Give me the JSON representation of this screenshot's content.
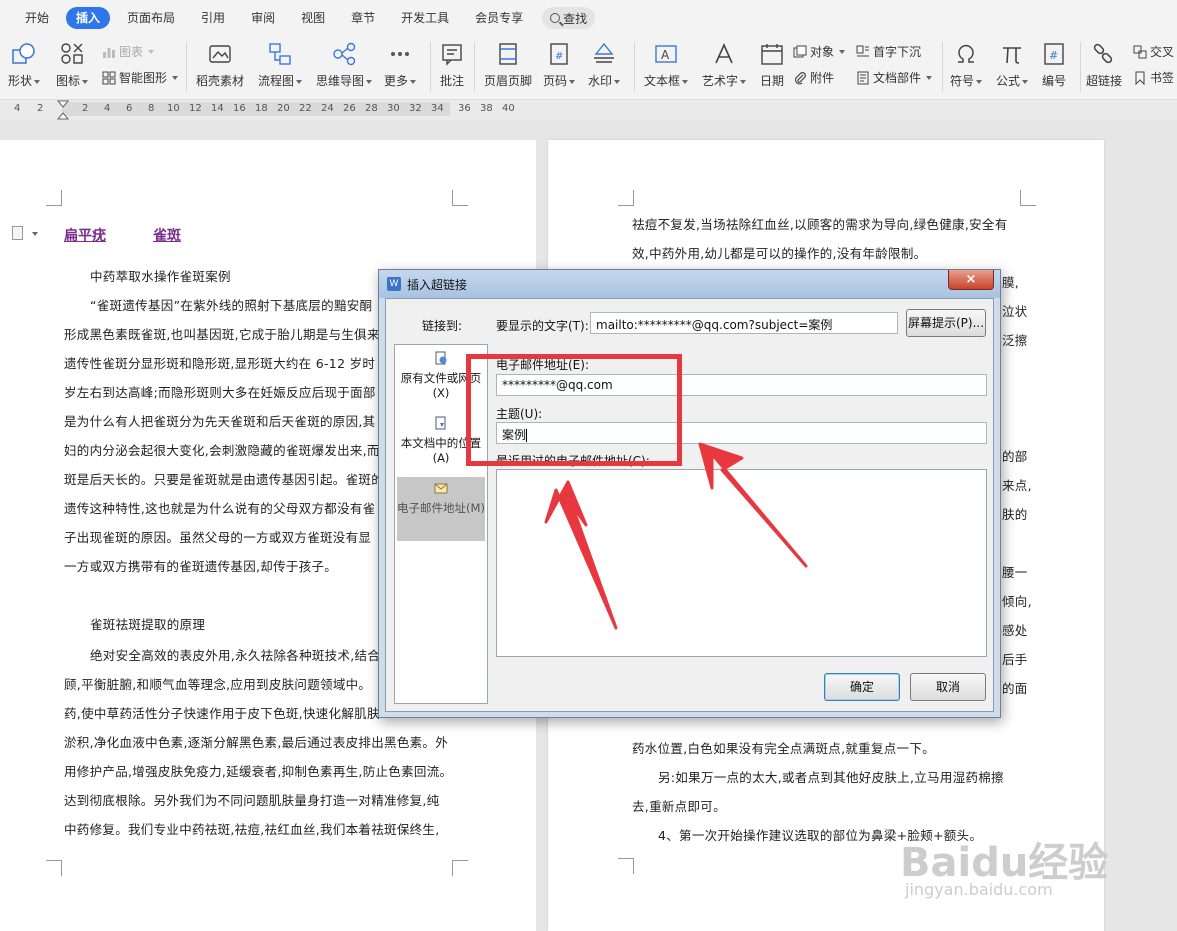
{
  "menu": {
    "items": [
      "开始",
      "插入",
      "页面布局",
      "引用",
      "审阅",
      "视图",
      "章节",
      "开发工具",
      "会员专享"
    ],
    "active_index": 1,
    "search_label": "查找"
  },
  "ribbon": {
    "shape": "形状",
    "icon": "图标",
    "chart": "图表",
    "smartart": "智能图形",
    "material": "稻壳素材",
    "flowchart": "流程图",
    "mindmap": "思维导图",
    "more": "更多",
    "comment": "批注",
    "header_footer": "页眉页脚",
    "page_number": "页码",
    "watermark": "水印",
    "textbox": "文本框",
    "wordart": "艺术字",
    "date": "日期",
    "object": "对象",
    "attachment": "附件",
    "dropcap": "首字下沉",
    "doc_parts": "文档部件",
    "symbol": "符号",
    "formula": "公式",
    "numbering": "编号",
    "hyperlink": "超链接",
    "crossref": "交叉",
    "bookmark": "书签"
  },
  "ruler": {
    "ticks": [
      "4",
      "2",
      "2",
      "4",
      "6",
      "8",
      "10",
      "12",
      "14",
      "16",
      "18",
      "20",
      "22",
      "24",
      "26",
      "28",
      "30",
      "32",
      "34",
      "36",
      "38",
      "40"
    ]
  },
  "left_page": {
    "links": [
      "扁平疣",
      "雀斑"
    ],
    "lines": [
      "中药萃取水操作雀斑案例",
      "“雀斑遗传基因”在紫外线的照射下基底层的黯安酮",
      "形成黑色素既雀斑,也叫基因斑,它成于胎儿期是与生俱来",
      "遗传性雀斑分显形斑和隐形斑,显形斑大约在 6-12 岁时",
      "岁左右到达高峰;而隐形斑则大多在妊娠反应后现于面部",
      "是为什么有人把雀斑分为先天雀斑和后天雀斑的原因,其",
      "妇的内分泌会起很大变化,会刺激隐藏的雀斑爆发出来,而",
      "斑是后天长的。只要是雀斑就是由遗传基因引起。雀斑的",
      "遗传这种特性,这也就是为什么说有的父母双方都没有雀",
      "子出现雀斑的原因。虽然父母的一方或双方雀斑没有显",
      "一方或双方携带有的雀斑遗传基因,却传于孩子。",
      "雀斑祛斑提取的原理",
      "绝对安全高效的表皮外用,永久祛除各种斑技术,结合",
      "顾,平衡脏腑,和顺气血等理念,应用到皮肤问题领域中。",
      "药,使中草药活性分子快速作用于皮下色斑,快速化解肌肤",
      "淤积,净化血液中色素,逐渐分解黑色素,最后通过表皮排出黑色素。外",
      "用修护产品,增强皮肤免疫力,延缓衰者,抑制色素再生,防止色素回流。",
      "达到彻底根除。另外我们为不同问题肌肤量身打造一对精准修复,纯",
      "中药修复。我们专业中药祛斑,祛痘,祛红血丝,我们本着祛斑保终生,"
    ]
  },
  "right_page": {
    "lines": [
      "祛痘不复发,当场祛除红血丝,以顾客的需求为导向,绿色健康,安全有",
      "效,中药外用,幼儿都是可以的操作的,没有年龄限制。",
      "药水位置,白色如果没有完全点满斑点,就重复点一下。",
      "另:如果万一点的太大,或者点到其他好皮肤上,立马用湿药棉擦",
      "去,重新点即可。",
      "4、第一次开始操作建议选取的部位为鼻梁+脸颊+额头。"
    ],
    "edge_chars": [
      "膜,",
      "泣状",
      "泛擦",
      "的部",
      "来点,",
      "肤的",
      "腰一",
      "倾向,",
      "感处",
      "后手",
      "的面"
    ]
  },
  "dialog": {
    "title": "插入超链接",
    "close_label": "×",
    "link_to_label": "链接到:",
    "display_text_label": "要显示的文字(T):",
    "display_text_value": "mailto:*********@qq.com?subject=案例",
    "screentip_label": "屏幕提示(P)...",
    "link_options": [
      "原有文件或网页(X)",
      "本文档中的位置(A)",
      "电子邮件地址(M)"
    ],
    "email_label": "电子邮件地址(E):",
    "email_value": "*********@qq.com",
    "subject_label": "主题(U):",
    "subject_value": "案例",
    "recent_label": "最近用过的电子邮件地址(C):",
    "ok_label": "确定",
    "cancel_label": "取消"
  },
  "colors": {
    "accent": "#2f76e8",
    "annotation": "#e8383f",
    "link_purple": "#7d2f8f"
  },
  "watermark": {
    "brand": "Baidu经验",
    "url": "jingyan.baidu.com"
  }
}
